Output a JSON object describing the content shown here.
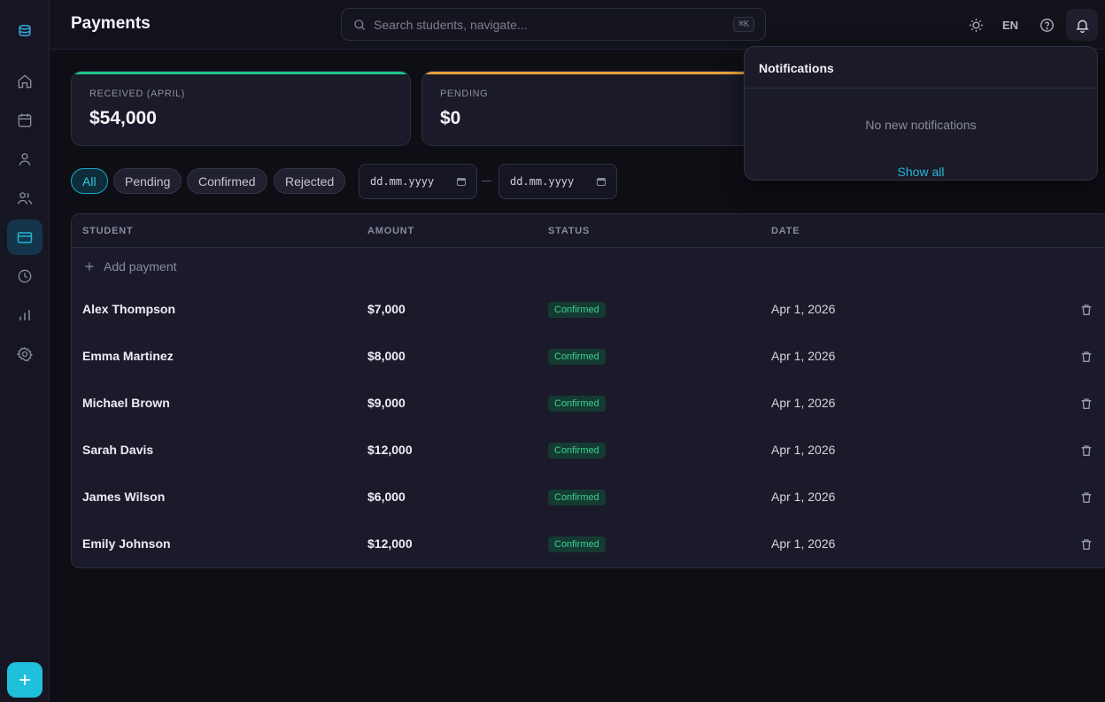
{
  "header": {
    "title": "Payments",
    "search_placeholder": "Search students, navigate...",
    "search_shortcut": "⌘K",
    "lang": "EN"
  },
  "sidebar": {
    "items": [
      {
        "name": "home",
        "icon": "home-icon"
      },
      {
        "name": "calendar",
        "icon": "calendar-icon"
      },
      {
        "name": "student",
        "icon": "user-icon"
      },
      {
        "name": "groups",
        "icon": "users-icon"
      },
      {
        "name": "payments",
        "icon": "credit-card-icon",
        "active": true
      },
      {
        "name": "history",
        "icon": "clock-icon"
      },
      {
        "name": "reports",
        "icon": "bar-chart-icon"
      },
      {
        "name": "settings",
        "icon": "gear-icon"
      }
    ]
  },
  "cards": [
    {
      "label": "RECEIVED (APRIL)",
      "value": "$54,000",
      "accent": "#1ec58a"
    },
    {
      "label": "PENDING",
      "value": "$0",
      "accent": "#e8a23a"
    }
  ],
  "filters": {
    "chips": [
      "All",
      "Pending",
      "Confirmed",
      "Rejected"
    ],
    "active": "All",
    "date_from_placeholder": "dd.mm.yyyy",
    "date_to_placeholder": "dd.mm.yyyy"
  },
  "table": {
    "columns": [
      "STUDENT",
      "AMOUNT",
      "STATUS",
      "DATE"
    ],
    "add_label": "Add payment",
    "rows": [
      {
        "student": "Alex Thompson",
        "amount": "$7,000",
        "status": "Confirmed",
        "date": "Apr 1, 2026"
      },
      {
        "student": "Emma Martinez",
        "amount": "$8,000",
        "status": "Confirmed",
        "date": "Apr 1, 2026"
      },
      {
        "student": "Michael Brown",
        "amount": "$9,000",
        "status": "Confirmed",
        "date": "Apr 1, 2026"
      },
      {
        "student": "Sarah Davis",
        "amount": "$12,000",
        "status": "Confirmed",
        "date": "Apr 1, 2026"
      },
      {
        "student": "James Wilson",
        "amount": "$6,000",
        "status": "Confirmed",
        "date": "Apr 1, 2026"
      },
      {
        "student": "Emily Johnson",
        "amount": "$12,000",
        "status": "Confirmed",
        "date": "Apr 1, 2026"
      }
    ]
  },
  "notifications": {
    "title": "Notifications",
    "empty_text": "No new notifications",
    "show_all": "Show all"
  }
}
